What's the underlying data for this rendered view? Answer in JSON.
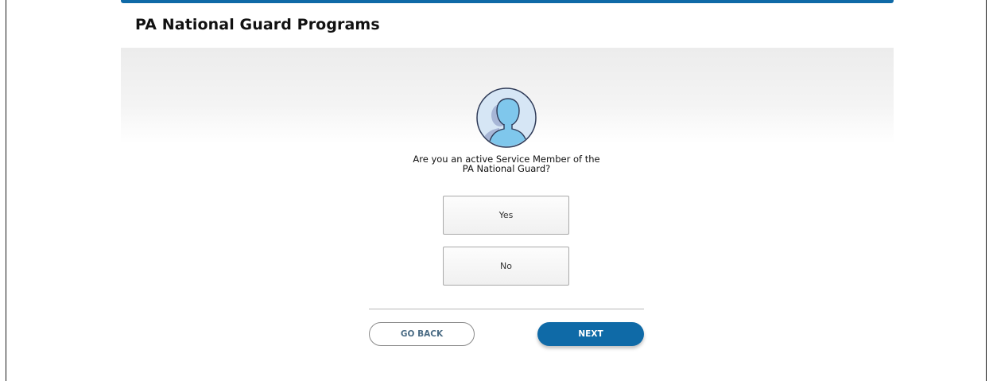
{
  "header": {
    "title": "PA National Guard Programs"
  },
  "question": {
    "icon": "user-avatar-icon",
    "line1": "Are you an active Service Member of the",
    "line2": "PA National Guard?"
  },
  "choices": [
    {
      "label": "Yes"
    },
    {
      "label": "No"
    }
  ],
  "footer": {
    "back_label": "GO BACK",
    "next_label": "NEXT"
  },
  "colors": {
    "accent": "#0f6aa7",
    "avatar_bg": "#d6e6f5",
    "avatar_figure": "#7fc7ec",
    "avatar_outline": "#2e3a57"
  }
}
